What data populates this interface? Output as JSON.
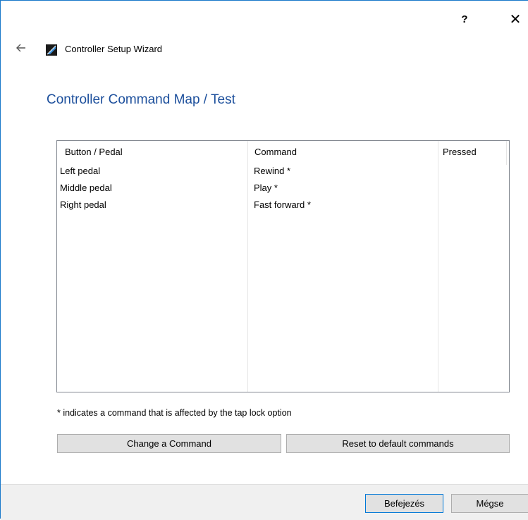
{
  "titlebar": {
    "help_label": "?",
    "close_label": "✕"
  },
  "header": {
    "back_icon": "back-arrow-icon",
    "app_icon": "controller-app-icon",
    "wizard_title": "Controller Setup Wizard"
  },
  "page": {
    "title": "Controller Command Map / Test"
  },
  "table": {
    "columns": [
      "Button / Pedal",
      "Command",
      "Pressed"
    ],
    "rows": [
      {
        "button": "Left pedal",
        "command": "Rewind *",
        "pressed": ""
      },
      {
        "button": "Middle pedal",
        "command": "Play *",
        "pressed": ""
      },
      {
        "button": "Right pedal",
        "command": "Fast forward *",
        "pressed": ""
      }
    ]
  },
  "footnote": "* indicates a command that is affected by the tap lock option",
  "buttons": {
    "change": "Change a Command",
    "reset": "Reset to default commands",
    "finish": "Befejezés",
    "cancel": "Mégse"
  },
  "colors": {
    "title_blue": "#1c4f9c",
    "accent": "#0078d7"
  }
}
